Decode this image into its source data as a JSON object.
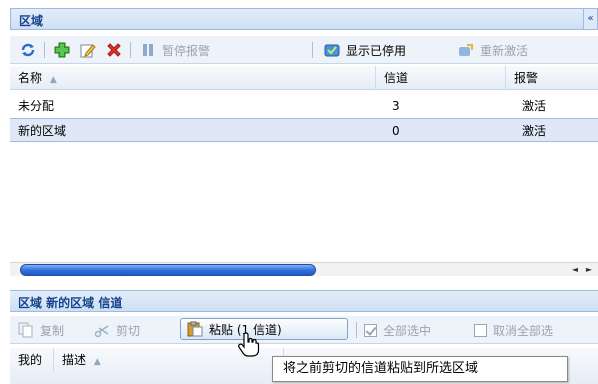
{
  "panel": {
    "title": "区域",
    "collapse_glyph": "«"
  },
  "toolbar": {
    "pause_alarm": "暂停报警",
    "show_disabled": "显示已停用",
    "reactivate": "重新激活"
  },
  "grid": {
    "columns": [
      "名称",
      "信道",
      "报警"
    ],
    "sort_indicator": "▲",
    "rows": [
      {
        "name": "未分配",
        "channels": "3",
        "alarm": "激活"
      },
      {
        "name": "新的区域",
        "channels": "0",
        "alarm": "激活"
      }
    ]
  },
  "scrollbar": {
    "left_arrow": "◄",
    "right_arrow": "►"
  },
  "subpanel": {
    "title": "区域 新的区域 信道"
  },
  "toolbar2": {
    "copy": "复制",
    "cut": "剪切",
    "paste": "粘贴 (1 信道)",
    "select_all": "全部选中",
    "deselect_all": "取消全部选"
  },
  "grid2": {
    "columns": [
      "我的",
      "描述"
    ],
    "sort_indicator": "▲"
  },
  "tooltip": {
    "text": "将之前剪切的信道粘贴到所选区域"
  },
  "colors": {
    "accent": "#15428b",
    "selection": "#dfe8f6",
    "toolbar_bg": "#eef3fa"
  }
}
